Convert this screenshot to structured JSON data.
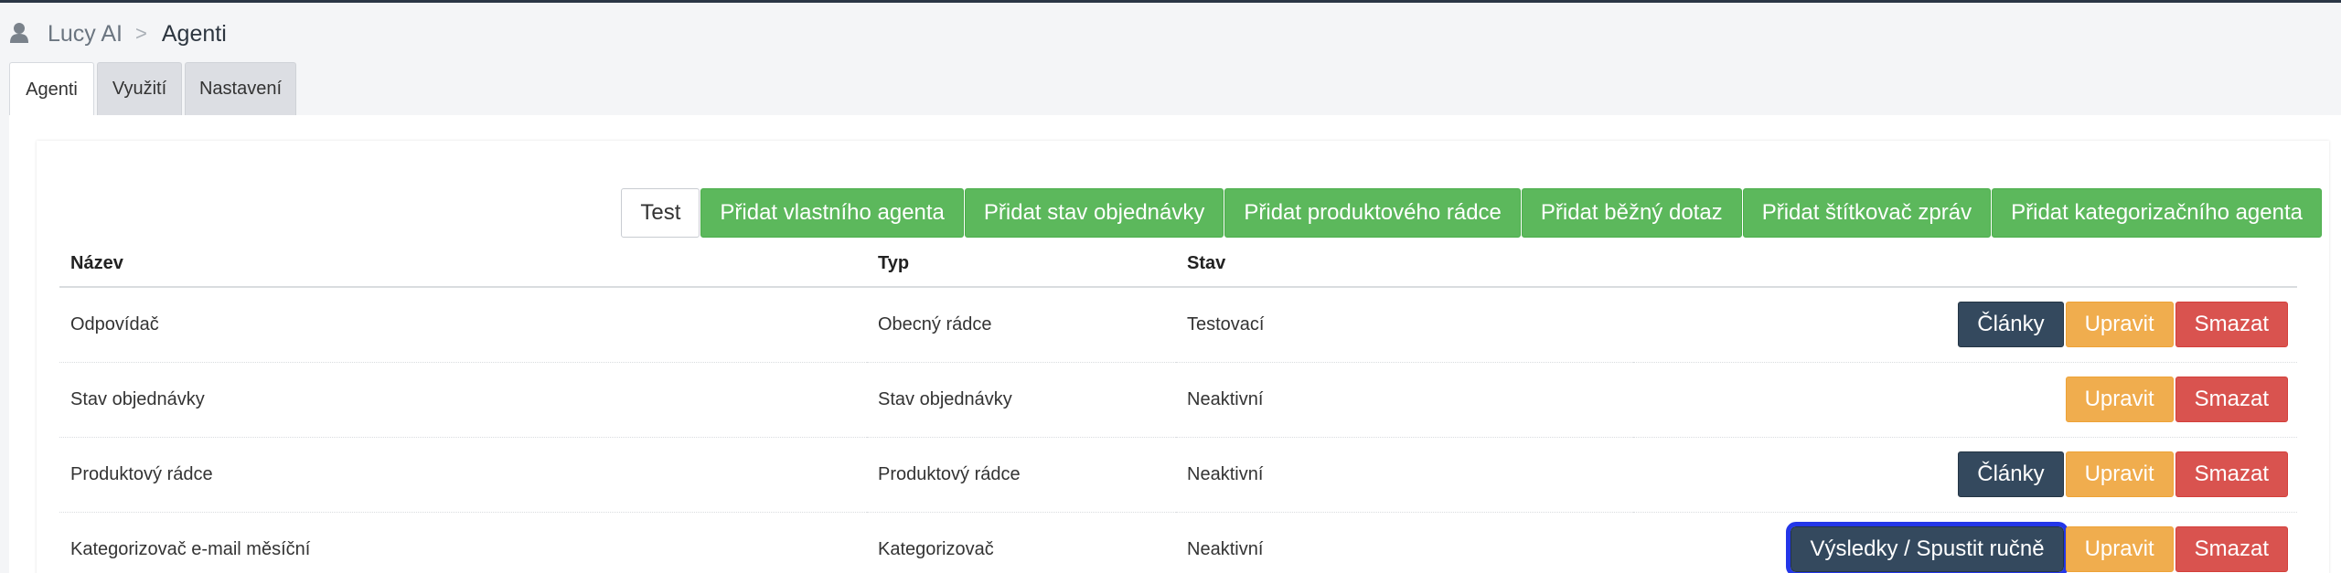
{
  "breadcrumb": {
    "icon": "user-icon",
    "root": "Lucy AI",
    "separator": ">",
    "current": "Agenti"
  },
  "tabs": [
    {
      "label": "Agenti",
      "active": true
    },
    {
      "label": "Využití",
      "active": false
    },
    {
      "label": "Nastavení",
      "active": false
    }
  ],
  "toolbar": {
    "test": "Test",
    "add_custom": "Přidat vlastního agenta",
    "add_order_status": "Přidat stav objednávky",
    "add_product_advisor": "Přidat produktového rádce",
    "add_common_query": "Přidat běžný dotaz",
    "add_message_tagger": "Přidat štítkovač zpráv",
    "add_categorization": "Přidat kategorizačního agenta"
  },
  "table": {
    "headers": {
      "name": "Název",
      "type": "Typ",
      "status": "Stav"
    },
    "rows": [
      {
        "name": "Odpovídač",
        "type": "Obecný rádce",
        "status": "Testovací",
        "articles": "Články",
        "edit": "Upravit",
        "delete": "Smazat"
      },
      {
        "name": "Stav objednávky",
        "type": "Stav objednávky",
        "status": "Neaktivní",
        "edit": "Upravit",
        "delete": "Smazat"
      },
      {
        "name": "Produktový rádce",
        "type": "Produktový rádce",
        "status": "Neaktivní",
        "articles": "Články",
        "edit": "Upravit",
        "delete": "Smazat"
      },
      {
        "name": "Kategorizovač e-mail měsíční",
        "type": "Kategorizovač",
        "status": "Neaktivní",
        "results": "Výsledky / Spustit ručně",
        "edit": "Upravit",
        "delete": "Smazat"
      }
    ]
  },
  "colors": {
    "success": "#5cb85c",
    "dark": "#34495e",
    "warning": "#f0ad4e",
    "danger": "#d9534f",
    "focus": "#2336e8"
  }
}
